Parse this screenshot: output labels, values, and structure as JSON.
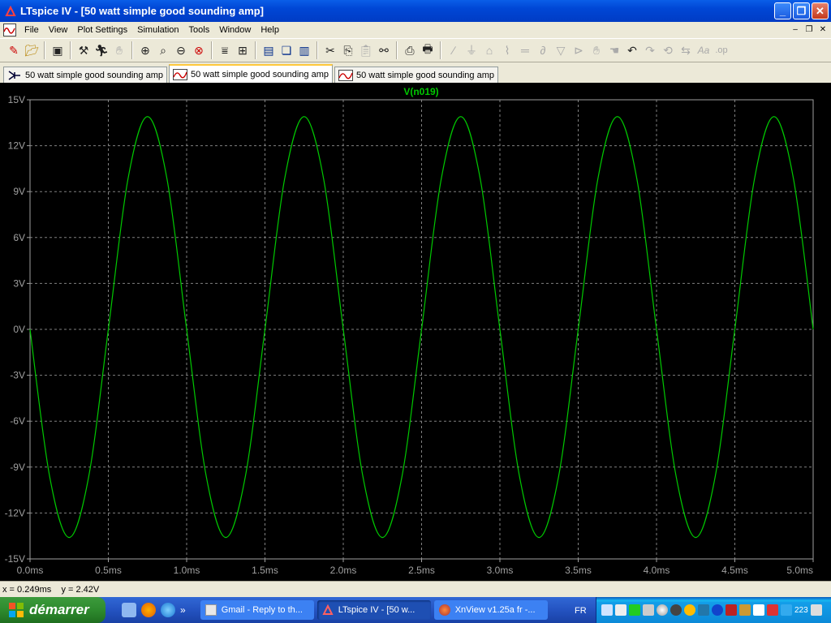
{
  "window": {
    "title": "LTspice IV - [50 watt simple good sounding amp]",
    "buttons": [
      "minimize",
      "restore",
      "close"
    ]
  },
  "menu": {
    "items": [
      "File",
      "View",
      "Plot Settings",
      "Simulation",
      "Tools",
      "Window",
      "Help"
    ]
  },
  "toolbar": {
    "icons": [
      "new-schematic-icon",
      "open-icon",
      "save-icon",
      "control-panel-icon",
      "run-icon",
      "halt-icon",
      "zoom-in-icon",
      "zoom-area-icon",
      "zoom-out-icon",
      "zoom-cancel-icon",
      "autorange-icon",
      "zoom-fit-icon",
      "tile-horizontal-icon",
      "cascade-icon",
      "tile-vertical-icon",
      "cut-icon",
      "copy-icon",
      "paste-icon",
      "find-icon",
      "print-setup-icon",
      "print-icon",
      "wire-icon",
      "ground-icon",
      "label-icon",
      "resistor-icon",
      "capacitor-icon",
      "inductor-icon",
      "diode-icon",
      "component-icon",
      "move-icon",
      "drag-icon",
      "undo-icon",
      "redo-icon",
      "rotate-icon",
      "mirror-icon",
      "text-icon",
      "spice-directive-icon"
    ]
  },
  "tabs": [
    {
      "label": "50 watt simple good sounding amp",
      "type": "schematic",
      "active": false
    },
    {
      "label": "50 watt simple good sounding amp",
      "type": "waveform",
      "active": true
    },
    {
      "label": "50 watt simple good sounding amp",
      "type": "waveform",
      "active": false
    }
  ],
  "chart_data": {
    "type": "line",
    "title": "",
    "series": [
      {
        "name": "V(n019)",
        "color": "#00c800",
        "x_ms": [
          0.0,
          0.125,
          0.25,
          0.375,
          0.5,
          0.625,
          0.75,
          0.875,
          1.0,
          1.125,
          1.25,
          1.375,
          1.5,
          1.625,
          1.75,
          1.875,
          2.0,
          2.125,
          2.25,
          2.375,
          2.5,
          2.625,
          2.75,
          2.875,
          3.0,
          3.125,
          3.25,
          3.375,
          3.5,
          3.625,
          3.75,
          3.875,
          4.0,
          4.125,
          4.25,
          4.375,
          4.5,
          4.625,
          4.75,
          4.875,
          5.0
        ],
        "y_V": [
          0.0,
          -9.6,
          -13.6,
          -9.6,
          0.0,
          9.8,
          13.9,
          9.8,
          0.0,
          -9.6,
          -13.6,
          -9.6,
          0.0,
          9.8,
          13.9,
          9.8,
          0.0,
          -9.6,
          -13.6,
          -9.6,
          0.0,
          9.8,
          13.9,
          9.8,
          0.0,
          -9.6,
          -13.6,
          -9.6,
          0.0,
          9.8,
          13.9,
          9.8,
          0.0,
          -9.6,
          -13.6,
          -9.6,
          0.0,
          9.8,
          13.9,
          9.8,
          0.0
        ]
      }
    ],
    "xlim": [
      0,
      5
    ],
    "ylim": [
      -15,
      15
    ],
    "xticks": [
      "0.0ms",
      "0.5ms",
      "1.0ms",
      "1.5ms",
      "2.0ms",
      "2.5ms",
      "3.0ms",
      "3.5ms",
      "4.0ms",
      "4.5ms",
      "5.0ms"
    ],
    "yticks": [
      "15V",
      "12V",
      "9V",
      "6V",
      "3V",
      "0V",
      "-3V",
      "-6V",
      "-9V",
      "-12V",
      "-15V"
    ],
    "grid": true,
    "background": "#000000",
    "grid_color": "#808080"
  },
  "status": {
    "text": "x = 0.249ms    y = 2.42V"
  },
  "taskbar": {
    "start_label": "démarrer",
    "tasks": [
      {
        "label": "Gmail - Reply to th...",
        "active": false
      },
      {
        "label": "LTspice IV - [50 w...",
        "active": true
      },
      {
        "label": "XnView v1.25a fr -...",
        "active": false
      }
    ],
    "lang": "FR",
    "tray_badge": "223"
  }
}
